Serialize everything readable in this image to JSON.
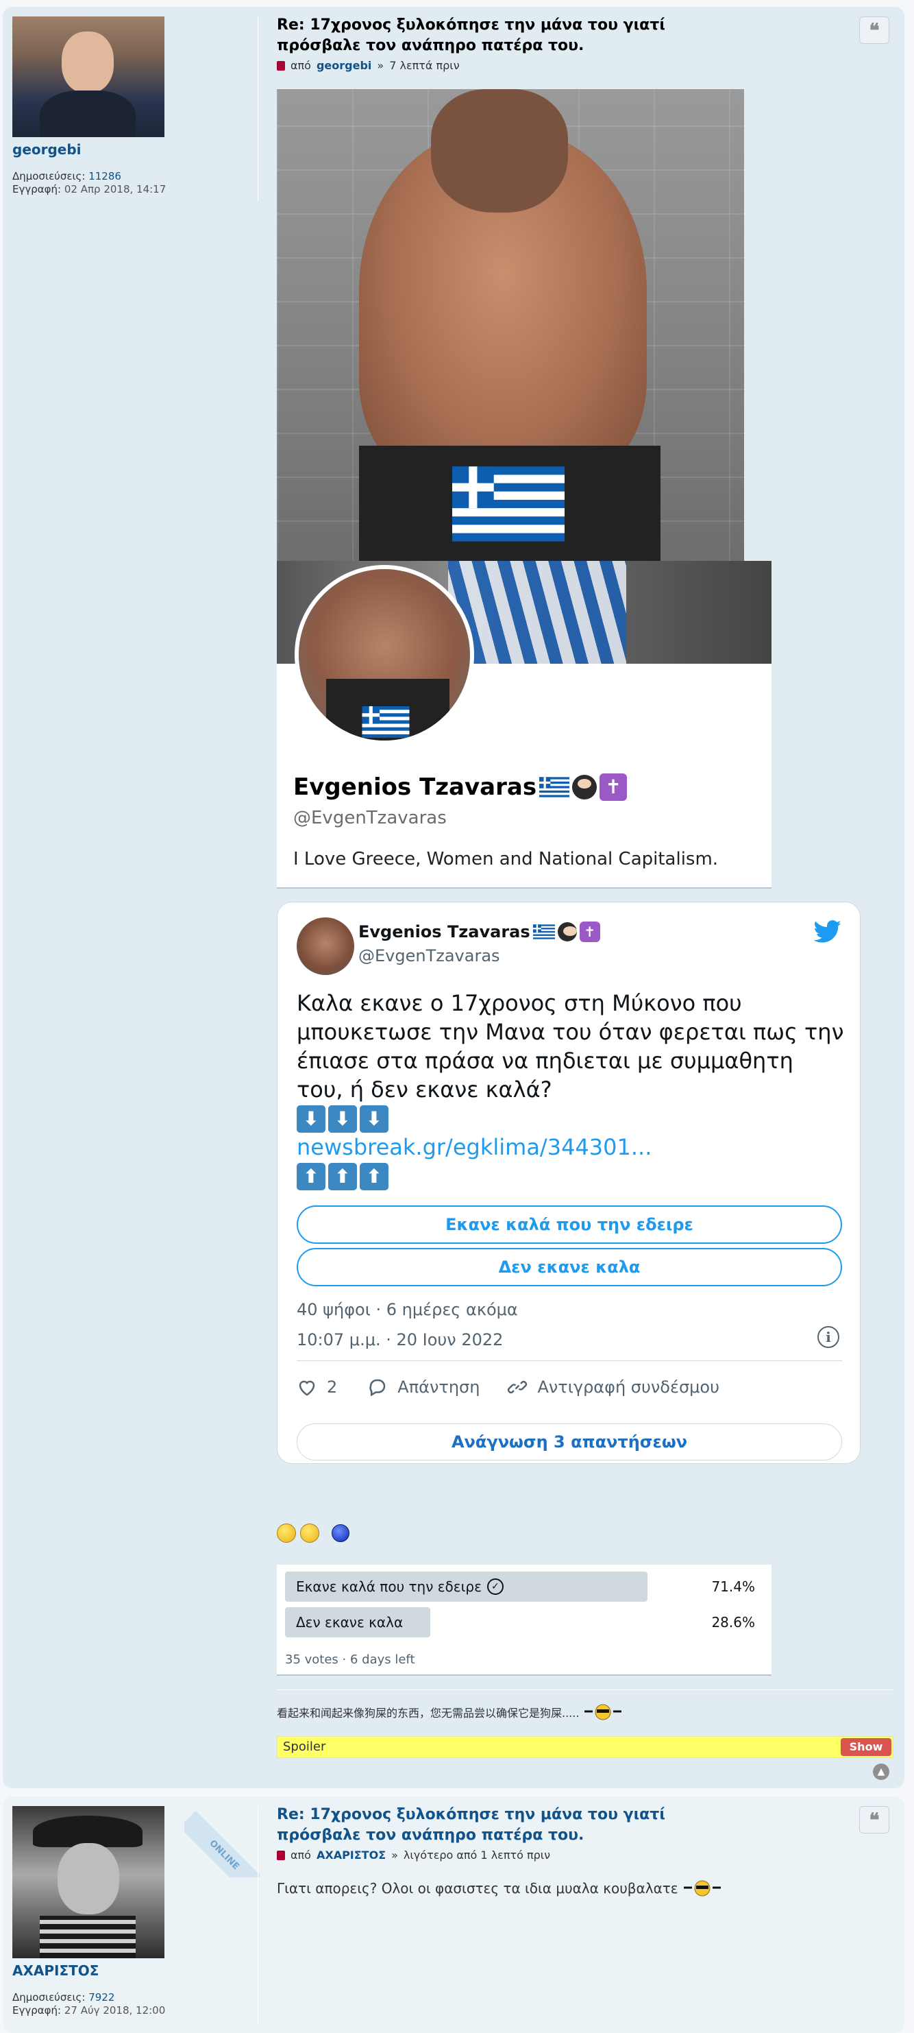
{
  "posts": [
    {
      "author": {
        "username": "georgebi",
        "posts_label": "Δημοσιεύσεις:",
        "posts_value": "11286",
        "joined_label": "Εγγραφή:",
        "joined_value": "02 Απρ 2018, 14:17"
      },
      "title": "Re: 17χρονος ξυλοκόπησε την μάνα του γιατί πρόσβαλε τον ανάπηρο πατέρα του.",
      "byline": {
        "prefix": "από",
        "author": "georgebi",
        "sep": "»",
        "time": "7 λεπτά πριν"
      },
      "twitter_profile": {
        "name": "Evgenios Tzavaras",
        "handle": "@EvgenTzavaras",
        "bio": "I Love Greece, Women and National Capitalism."
      },
      "tweet": {
        "name": "Evgenios Tzavaras",
        "handle": "@EvgenTzavaras",
        "text": "Καλα εκανε ο 17χρονος στη  Μύκονο που μπουκετωσε την Μανα του όταν φερεται πως την έπιασε στα πράσα να πηδιεται με συμμαθητη του, ή δεν εκανε καλά?",
        "arrows_down": [
          "⬇",
          "⬇",
          "⬇"
        ],
        "link": "newsbreak.gr/egklima/344301...",
        "arrows_up": [
          "⬆",
          "⬆",
          "⬆"
        ],
        "options": [
          "Εκανε καλά που την εδειρε",
          "Δεν εκανε καλα"
        ],
        "poll_meta": "40 ψήφοι · 6 ημέρες ακόμα",
        "timestamp": "10:07 μ.μ. · 20 Ιουν 2022",
        "likes": "2",
        "reply_label": "Απάντηση",
        "copy_label": "Αντιγραφή συνδέσμου",
        "read_replies": "Ανάγνωση 3 απαντήσεων"
      },
      "poll": {
        "options": [
          {
            "label": "Εκανε καλά που την εδειρε",
            "percent": "71.4%",
            "value": 71.4,
            "winner": true
          },
          {
            "label": "Δεν εκανε καλα",
            "percent": "28.6%",
            "value": 28.6,
            "winner": false
          }
        ],
        "meta": "35 votes · 6 days left"
      },
      "signature": "看起来和闻起来像狗屎的东西，您无需品尝以确保它是狗屎.....",
      "spoiler": {
        "label": "Spoiler",
        "button": "Show"
      }
    },
    {
      "author": {
        "username": "ΑΧΑΡΙΣΤΟΣ",
        "ribbon": "ONLINE",
        "posts_label": "Δημοσιεύσεις:",
        "posts_value": "7922",
        "joined_label": "Εγγραφή:",
        "joined_value": "27 Αύγ 2018, 12:00"
      },
      "title": "Re: 17χρονος ξυλοκόπησε την μάνα του γιατί πρόσβαλε τον ανάπηρο πατέρα του.",
      "byline": {
        "prefix": "από",
        "author": "ΑΧΑΡΙΣΤΟΣ",
        "sep": "»",
        "time": "λιγότερο από 1 λεπτό πριν"
      },
      "text": "Γιατι απορεις? Ολοι οι φασιστες τα ιδια μυαλα κουβαλατε"
    }
  ],
  "colors": {
    "accent": "#105289",
    "twitter_blue": "#1d9bf0",
    "post_bg": "#e1ebf2",
    "spoiler_bg": "#ffff66",
    "show_btn": "#d9534f"
  }
}
